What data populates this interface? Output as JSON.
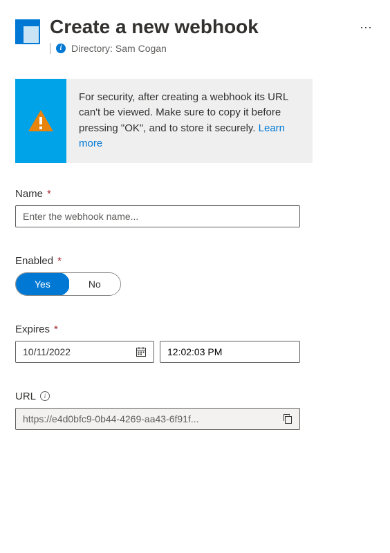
{
  "header": {
    "title": "Create a new webhook",
    "directory_prefix": "Directory:",
    "directory_value": "Sam Cogan"
  },
  "warning": {
    "text": "For security, after creating a webhook its URL can't be viewed. Make sure to copy it before pressing \"OK\", and to store it securely. ",
    "link_text": "Learn more"
  },
  "fields": {
    "name": {
      "label": "Name",
      "placeholder": "Enter the webhook name...",
      "value": ""
    },
    "enabled": {
      "label": "Enabled",
      "yes": "Yes",
      "no": "No",
      "selected": "yes"
    },
    "expires": {
      "label": "Expires",
      "date": "10/11/2022",
      "time": "12:02:03 PM"
    },
    "url": {
      "label": "URL",
      "value": "https://e4d0bfc9-0b44-4269-aa43-6f91f..."
    }
  }
}
